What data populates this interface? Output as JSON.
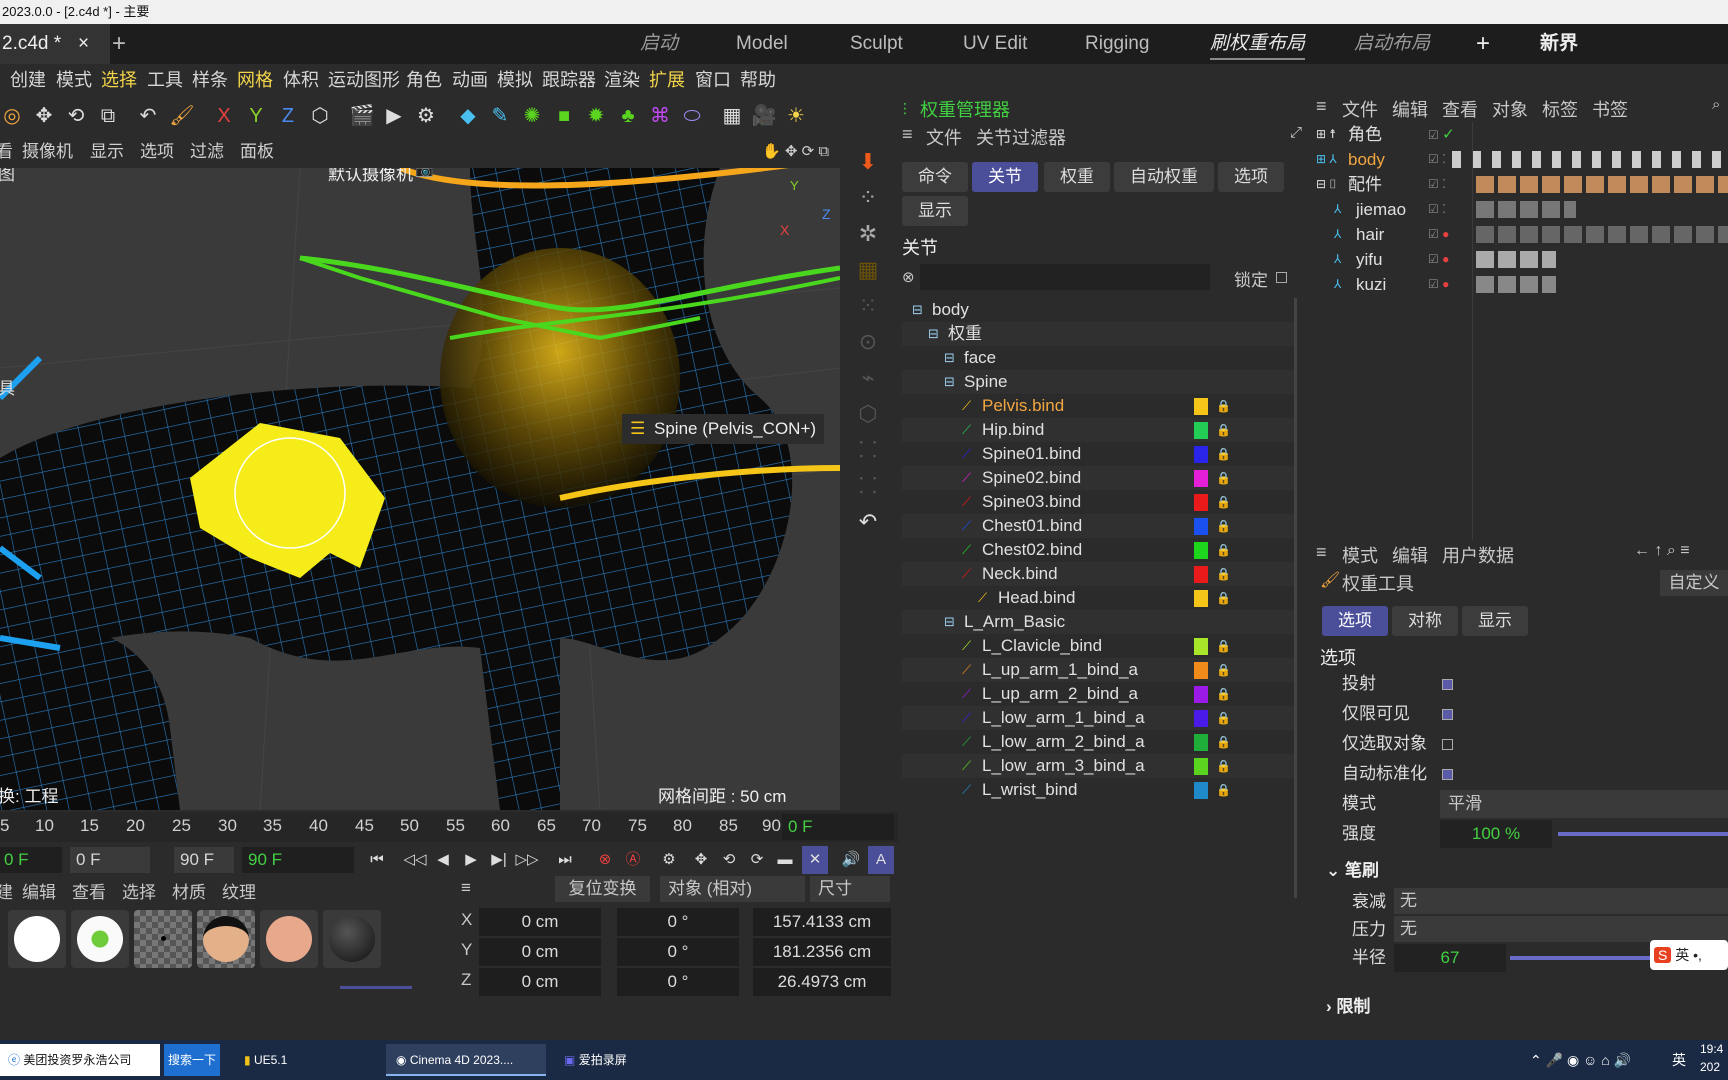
{
  "window": {
    "title": "2023.0.0 - [2.c4d *] - 主要"
  },
  "tabs": {
    "doc": "2.c4d *",
    "close": "×",
    "add": "+"
  },
  "layouts": [
    "启动",
    "Model",
    "Sculpt",
    "UV Edit",
    "Rigging",
    "刷权重布局",
    "启动布局",
    "+",
    "新界"
  ],
  "menu": [
    "创建",
    "模式",
    "选择",
    "工具",
    "样条",
    "网格",
    "体积",
    "运动图形",
    "角色",
    "动画",
    "模拟",
    "跟踪器",
    "渲染",
    "扩展",
    "窗口",
    "帮助"
  ],
  "viewport_menu": [
    "看",
    "摄像机",
    "显示",
    "选项",
    "过滤",
    "面板"
  ],
  "viewport": {
    "camera": "默认摄像机",
    "left_label": "图",
    "tool_label": "具",
    "tooltip": "Spine (Pelvis_CON+)",
    "bottom_left": "换: 工程",
    "grid": "网格间距 : 50 cm",
    "axes": [
      "Y",
      "Z",
      "X"
    ]
  },
  "timeline": {
    "ticks": [
      "5",
      "10",
      "15",
      "20",
      "25",
      "30",
      "35",
      "40",
      "45",
      "50",
      "55",
      "60",
      "65",
      "70",
      "75",
      "80",
      "85",
      "90"
    ],
    "current": "0 F"
  },
  "transport": {
    "start": "0 F",
    "min": "0 F",
    "max": "90 F",
    "end": "90 F"
  },
  "materials": {
    "menu": [
      "建",
      "编辑",
      "查看",
      "选择",
      "材质",
      "纹理"
    ]
  },
  "coords": {
    "reset": "复位变换",
    "mode": "对象 (相对)",
    "size": "尺寸",
    "axes": [
      "X",
      "Y",
      "Z"
    ],
    "pos": [
      "0 cm",
      "0 cm",
      "0 cm"
    ],
    "rot": [
      "0 °",
      "0 °",
      "0 °"
    ],
    "scale": [
      "157.4133 cm",
      "181.2356 cm",
      "26.4973 cm"
    ]
  },
  "weight_manager": {
    "title": "权重管理器",
    "menu": [
      "文件",
      "关节过滤器"
    ],
    "tabs": [
      "命令",
      "关节",
      "权重",
      "自动权重",
      "选项",
      "显示"
    ],
    "section": "关节",
    "lock": "锁定",
    "tree": [
      {
        "label": "body",
        "indent": 0,
        "color": null
      },
      {
        "label": "权重",
        "indent": 1,
        "color": null
      },
      {
        "label": "face",
        "indent": 2,
        "color": null
      },
      {
        "label": "Spine",
        "indent": 2,
        "color": null
      },
      {
        "label": "Pelvis.bind",
        "indent": 3,
        "color": "#f5c518",
        "sel": true
      },
      {
        "label": "Hip.bind",
        "indent": 3,
        "color": "#22cc55"
      },
      {
        "label": "Spine01.bind",
        "indent": 3,
        "color": "#2a23e8"
      },
      {
        "label": "Spine02.bind",
        "indent": 3,
        "color": "#e51ed8"
      },
      {
        "label": "Spine03.bind",
        "indent": 3,
        "color": "#e81a1a"
      },
      {
        "label": "Chest01.bind",
        "indent": 3,
        "color": "#1a4ff0"
      },
      {
        "label": "Chest02.bind",
        "indent": 3,
        "color": "#1ed51e"
      },
      {
        "label": "Neck.bind",
        "indent": 3,
        "color": "#e81a1a"
      },
      {
        "label": "Head.bind",
        "indent": 4,
        "color": "#f5c518"
      },
      {
        "label": "L_Arm_Basic",
        "indent": 2,
        "color": null
      },
      {
        "label": "L_Clavicle_bind",
        "indent": 3,
        "color": "#a8e62a"
      },
      {
        "label": "L_up_arm_1_bind_a",
        "indent": 3,
        "color": "#f08a1a"
      },
      {
        "label": "L_up_arm_2_bind_a",
        "indent": 3,
        "color": "#9b1ae8"
      },
      {
        "label": "L_low_arm_1_bind_a",
        "indent": 3,
        "color": "#4a1ae8"
      },
      {
        "label": "L_low_arm_2_bind_a",
        "indent": 3,
        "color": "#1fae3a"
      },
      {
        "label": "L_low_arm_3_bind_a",
        "indent": 3,
        "color": "#5ad41e"
      },
      {
        "label": "L_wrist_bind",
        "indent": 3,
        "color": "#1e8bc8"
      }
    ]
  },
  "objects": {
    "menu": [
      "文件",
      "编辑",
      "查看",
      "对象",
      "标签",
      "书签"
    ],
    "rows": [
      "角色",
      "body",
      "配件",
      "jiemao",
      "hair",
      "yifu",
      "kuzi"
    ]
  },
  "attributes": {
    "menu": [
      "模式",
      "编辑",
      "用户数据"
    ],
    "tool": "权重工具",
    "custom": "自定义",
    "tabs": [
      "选项",
      "对称",
      "显示"
    ],
    "section": "选项",
    "options": [
      "投射",
      "仅限可见",
      "仅选取对象",
      "自动标准化"
    ],
    "mode_label": "模式",
    "mode_value": "平滑",
    "strength_label": "强度",
    "strength_value": "100 %",
    "brush_section": "笔刷",
    "falloff_label": "衰减",
    "falloff_value": "无",
    "pressure_label": "压力",
    "pressure_value": "无",
    "radius_label": "半径",
    "radius_value": "67",
    "limit_section": "限制"
  },
  "taskbar": {
    "items": [
      "美团投资罗永浩公司",
      "搜索一下",
      "UE5.1",
      "Cinema 4D 2023....",
      "爱拍录屏"
    ],
    "clock": "19:4",
    "date": "202",
    "ime": "英"
  },
  "colors": {
    "accent": "#4b4f9a",
    "highlight": "#f2d44b",
    "green": "#42d042"
  }
}
